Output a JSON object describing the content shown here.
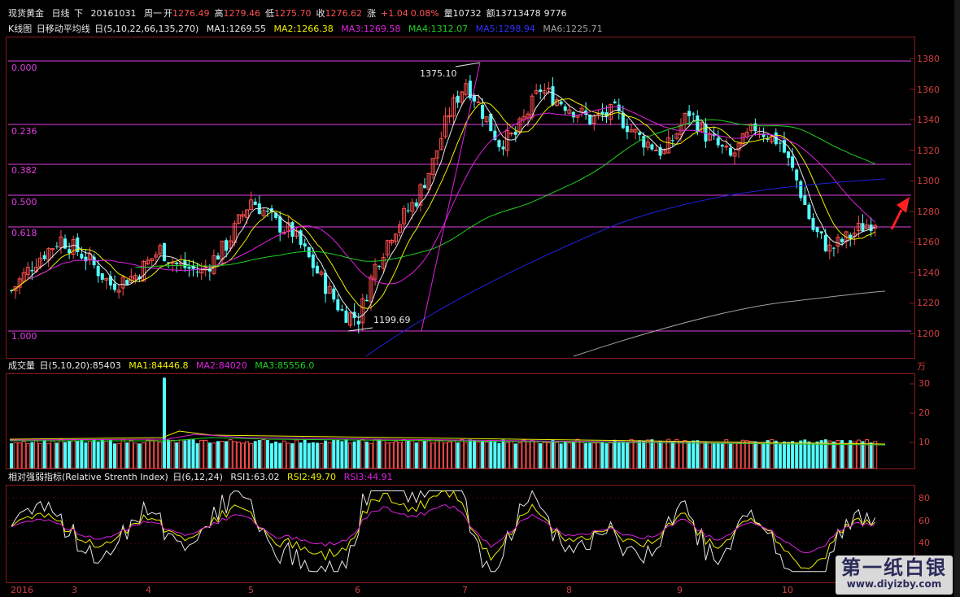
{
  "header": {
    "instrument": "现货黄金",
    "period": "日线",
    "direction": "下",
    "date": "20161031",
    "weekday": "周一",
    "open_label": "开",
    "open": "1276.49",
    "high_label": "高",
    "high": "1279.46",
    "low_label": "低",
    "low": "1275.70",
    "close_label": "收",
    "close": "1276.62",
    "change_label": "涨",
    "change": "+1.04",
    "change_pct": "0.08%",
    "volume_label": "量",
    "volume": "10732",
    "amount_label": "额",
    "amount": "13713478",
    "extra": "9776"
  },
  "kline": {
    "title": "K线图",
    "indicator": "日移动平均线",
    "period": "日",
    "params": "(5,10,22,66,135,270)",
    "ma": [
      {
        "label": "MA1:1269.55",
        "color": "#e8e8e8"
      },
      {
        "label": "MA2:1266.38",
        "color": "#f0f000"
      },
      {
        "label": "MA3:1269.58",
        "color": "#e020e0"
      },
      {
        "label": "MA4:1312.07",
        "color": "#20d020"
      },
      {
        "label": "MA5:1298.94",
        "color": "#2020e0"
      },
      {
        "label": "MA6:1225.71",
        "color": "#a0a0a0"
      }
    ],
    "y_ticks": [
      "1380",
      "1360",
      "1340",
      "1320",
      "1300",
      "1280",
      "1260",
      "1240",
      "1220",
      "1200"
    ],
    "fib_levels": [
      "0.000",
      "0.236",
      "0.382",
      "0.500",
      "0.618",
      "1.000"
    ],
    "high_annotation": "1375.10",
    "low_annotation": "1199.69"
  },
  "volume": {
    "title": "成交量",
    "period": "日",
    "params": "(5,10,20)",
    "value": ":85403",
    "ma": [
      {
        "label": "MA1:84446.8",
        "color": "#f0f000"
      },
      {
        "label": "MA2:84020",
        "color": "#e020e0"
      },
      {
        "label": "MA3:85556.0",
        "color": "#20d020"
      }
    ],
    "unit": "万",
    "y_ticks": [
      "30",
      "20",
      "10"
    ]
  },
  "rsi": {
    "title": "相对强弱指标(Relative Strenth Index)",
    "period": "日",
    "params": "(6,12,24)",
    "values": [
      {
        "label": "RSI1:63.02",
        "color": "#e8e8e8"
      },
      {
        "label": "RSI2:49.70",
        "color": "#f0f000"
      },
      {
        "label": "RSI3:44.91",
        "color": "#e020e0"
      }
    ],
    "y_ticks": [
      "80",
      "60",
      "40"
    ]
  },
  "x_axis": [
    "2016",
    "3",
    "4",
    "5",
    "6",
    "7",
    "8",
    "9",
    "10"
  ],
  "colors": {
    "up": "#ff5050",
    "down": "#54ffff",
    "frame": "#8b1a1a",
    "fib": "#e040e0"
  },
  "logo": {
    "name": "第一纸白银",
    "url": "www.diyizby.com"
  },
  "chart_data": {
    "type": "line",
    "title": "",
    "y_range": [
      1190,
      1385
    ],
    "ma_end_values": {
      "MA1": 1269.55,
      "MA2": 1266.38,
      "MA3": 1269.58,
      "MA4": 1312.07,
      "MA5": 1298.94,
      "MA6": 1225.71
    },
    "price_high": 1375.1,
    "price_low": 1199.69,
    "last_close": 1276.62
  }
}
